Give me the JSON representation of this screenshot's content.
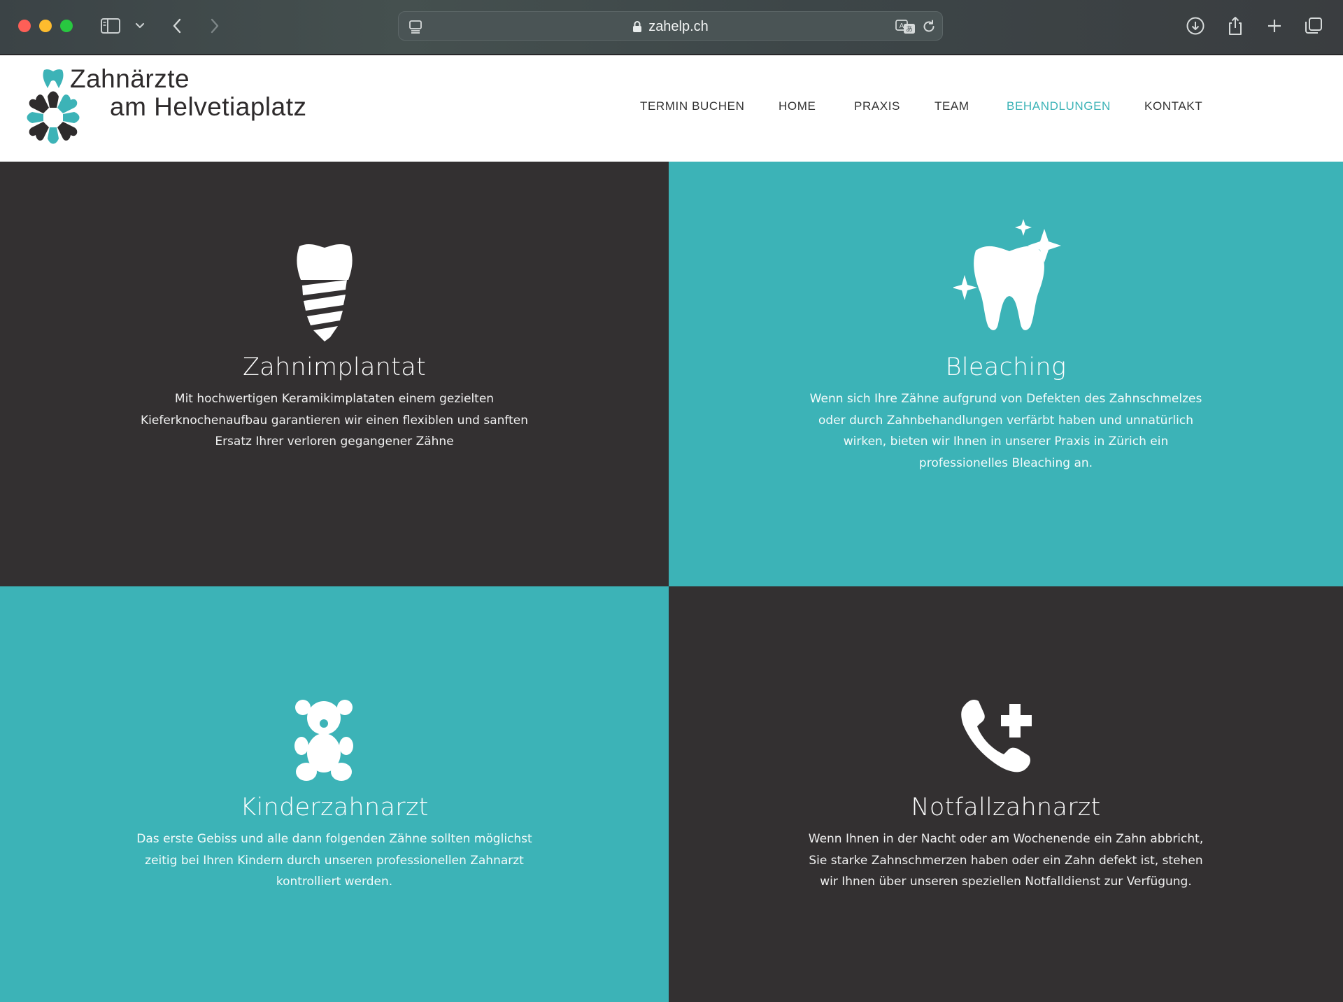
{
  "browser": {
    "url": "zahelp.ch"
  },
  "site": {
    "logo_line1": "Zahnärzte",
    "logo_line2": "am Helvetiaplatz"
  },
  "nav": [
    {
      "label": "TERMIN BUCHEN"
    },
    {
      "label": "HOME"
    },
    {
      "label": "PRAXIS"
    },
    {
      "label": "TEAM"
    },
    {
      "label": "BEHANDLUNGEN"
    },
    {
      "label": "KONTAKT"
    }
  ],
  "colors": {
    "accent": "#3cb3b7",
    "dark": "#333031",
    "white": "#ffffff"
  },
  "tiles": [
    {
      "title": "Zahnimplantat",
      "icon": "dental-implant-icon",
      "lines": [
        "Mit hochwertigen Keramikimplataten einem gezielten",
        "Kieferknochenaufbau garantieren wir einen flexiblen und sanften",
        "Ersatz Ihrer verloren gegangener Zähne"
      ]
    },
    {
      "title": "Bleaching",
      "icon": "sparkling-tooth-icon",
      "lines": [
        "Wenn sich Ihre Zähne aufgrund von Defekten des Zahnschmelzes",
        "oder durch Zahnbehandlungen verfärbt haben und unnatürlich",
        "wirken, bieten wir Ihnen in unserer Praxis in Zürich ein",
        "professionelles Bleaching an."
      ]
    },
    {
      "title": "Kinderzahnarzt",
      "icon": "teddy-bear-icon",
      "lines": [
        "Das erste Gebiss und alle dann folgenden Zähne sollten möglichst",
        "zeitig bei Ihren Kindern durch unseren professionellen Zahnarzt",
        "kontrolliert werden."
      ]
    },
    {
      "title": "Notfallzahnarzt",
      "icon": "emergency-phone-icon",
      "lines": [
        "Wenn Ihnen in der Nacht oder am Wochenende ein Zahn abbricht,",
        "Sie starke Zahnschmerzen haben oder ein Zahn defekt ist, stehen",
        "wir Ihnen über unseren speziellen Notfalldienst zur Verfügung."
      ]
    }
  ]
}
